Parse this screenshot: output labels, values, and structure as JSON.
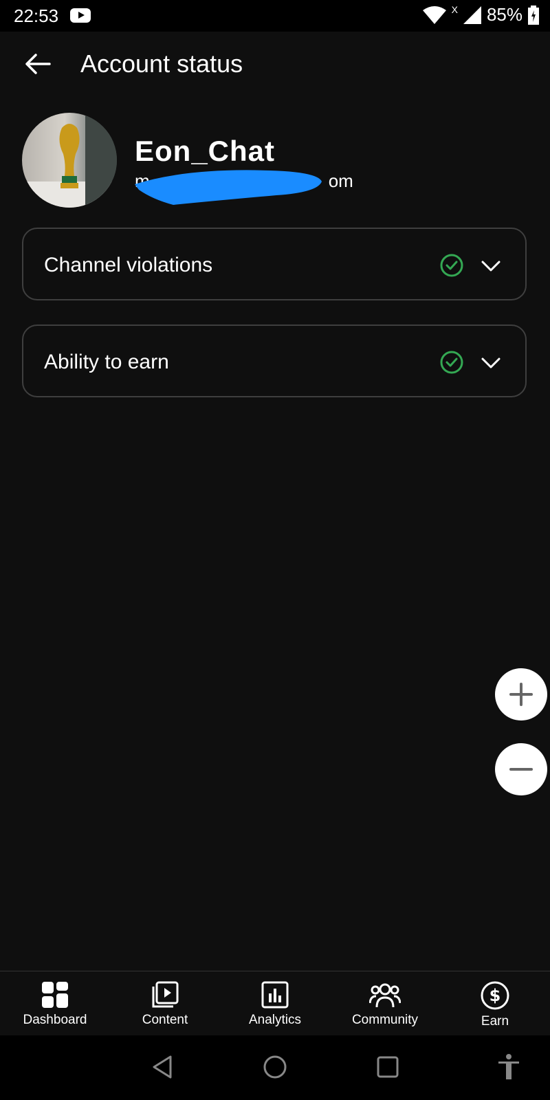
{
  "status_bar": {
    "time": "22:53",
    "network": "X",
    "battery": "85%"
  },
  "header": {
    "title": "Account status"
  },
  "channel": {
    "name": "Eon_Chat",
    "email": "m                                    om"
  },
  "cards": [
    {
      "label": "Channel violations",
      "status": "ok"
    },
    {
      "label": "Ability to earn",
      "status": "ok"
    }
  ],
  "nav": [
    {
      "label": "Dashboard",
      "icon": "dashboard-icon"
    },
    {
      "label": "Content",
      "icon": "content-icon"
    },
    {
      "label": "Analytics",
      "icon": "analytics-icon"
    },
    {
      "label": "Community",
      "icon": "community-icon"
    },
    {
      "label": "Earn",
      "icon": "earn-icon"
    }
  ],
  "colors": {
    "accent_check": "#34a853",
    "background": "#0f0f0f",
    "redaction": "#1a8cff"
  }
}
